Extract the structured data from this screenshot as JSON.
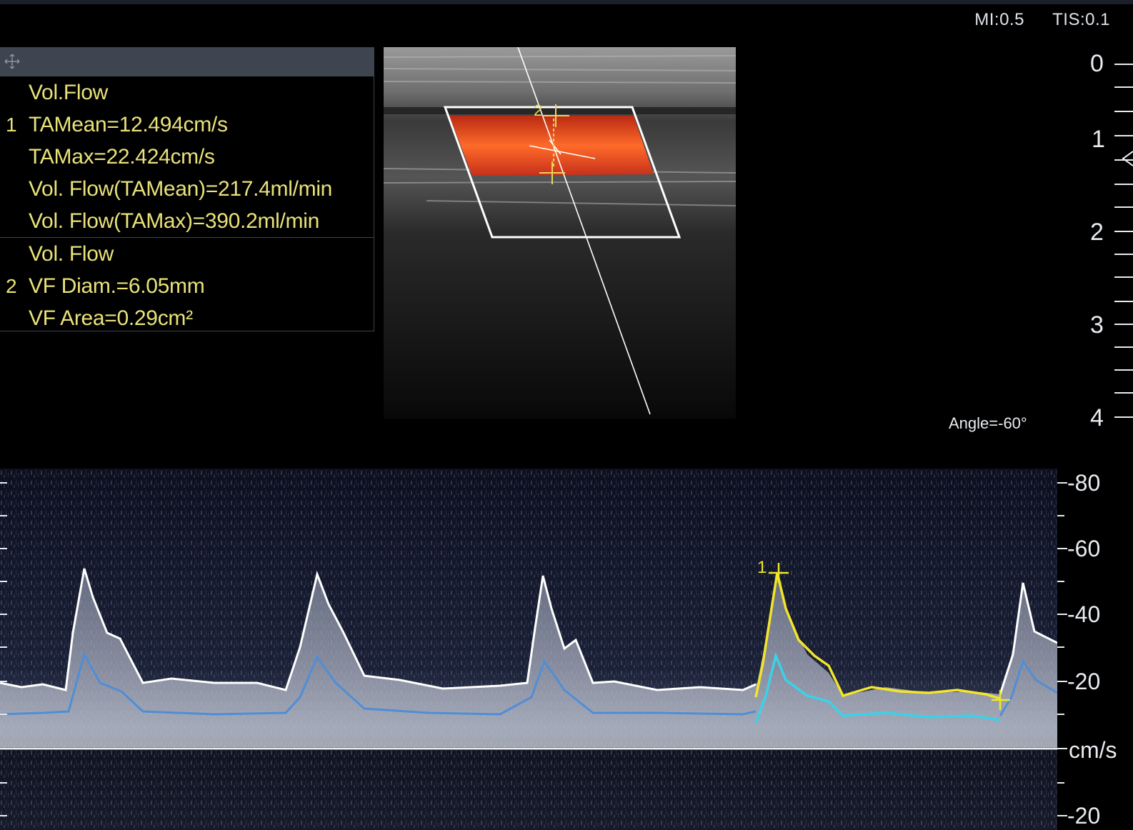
{
  "header": {
    "mi": "MI:0.5",
    "tis": "TIS:0.1"
  },
  "measurements": {
    "groups": [
      {
        "number": "1",
        "lines": [
          "Vol.Flow",
          "TAMean=12.494cm/s",
          "TAMax=22.424cm/s",
          "Vol. Flow(TAMean)=217.4ml/min",
          "Vol. Flow(TAMax)=390.2ml/min"
        ]
      },
      {
        "number": "2",
        "lines": [
          "Vol. Flow",
          "VF Diam.=6.05mm",
          "VF Area=0.29cm²"
        ]
      }
    ]
  },
  "bmode": {
    "markers": [
      "2"
    ],
    "colors": {
      "flow": "#e8431c",
      "box": "#ffffff",
      "caliper": "#e6d65a"
    }
  },
  "depth_scale": {
    "labels": [
      "0",
      "1",
      "2",
      "3",
      "4"
    ]
  },
  "angle": "Angle=-60°",
  "spectrum": {
    "marker": "1",
    "velocity_labels": [
      "-80",
      "-60",
      "-40",
      "-20",
      "cm/s",
      "-20"
    ],
    "colors": {
      "max_trace": "#ffffff",
      "mean_trace": "#4f8ed6",
      "measured_max": "#f2e52b",
      "measured_mean": "#39d2e8"
    }
  }
}
